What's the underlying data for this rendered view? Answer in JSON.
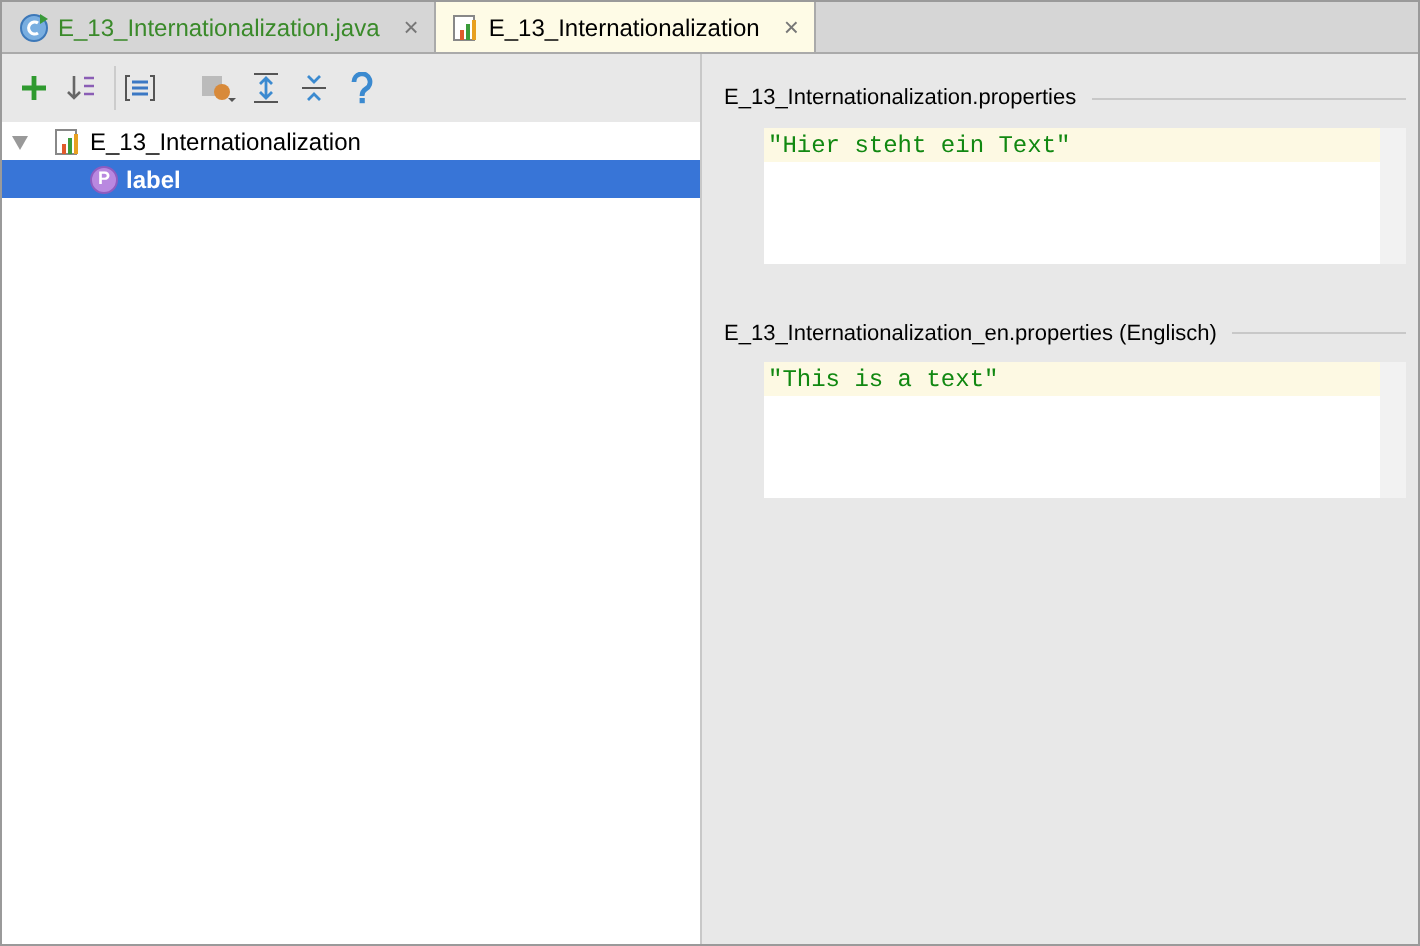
{
  "tabs": [
    {
      "label": "E_13_Internationalization.java",
      "kind": "java",
      "selected": false,
      "close": "×"
    },
    {
      "label": "E_13_Internationalization",
      "kind": "bundle",
      "selected": true,
      "close": "×"
    }
  ],
  "tree": [
    {
      "label": "E_13_Internationalization",
      "kind": "bundle",
      "expanded": true,
      "selected": false,
      "children": [
        {
          "label": "label",
          "kind": "property",
          "badge": "P",
          "selected": true
        }
      ]
    }
  ],
  "editors": [
    {
      "title": "E_13_Internationalization.properties",
      "value": "\"Hier steht ein Text\""
    },
    {
      "title": "E_13_Internationalization_en.properties (Englisch)",
      "value": "\"This is a text\""
    }
  ]
}
